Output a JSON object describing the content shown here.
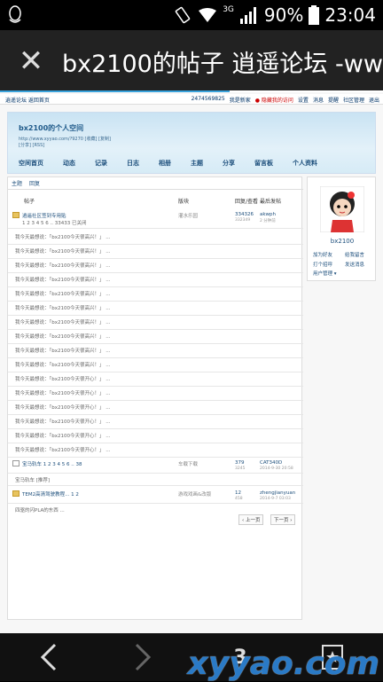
{
  "status": {
    "network": "3G",
    "battery": "90%",
    "time": "23:04"
  },
  "browser": {
    "title": "bx2100的帖子 逍遥论坛 -ww",
    "load_progress": 0.6
  },
  "site": {
    "topnav_left": "逍遥论坛  返回首页",
    "topnav_id": "2474569825",
    "topnav_items": [
      "我是新家",
      "● 隐藏我的访问",
      "设置",
      "消息",
      "提醒",
      "社区管理",
      "退出"
    ],
    "space_name": "bx2100的个人空间",
    "space_url": "http://www.xyyao.com/?9270 [收藏] [复制]",
    "space_rss": "[分享] [RSS]",
    "tabs": [
      "空间首页",
      "动态",
      "记录",
      "日志",
      "相册",
      "主题",
      "分享",
      "留言板",
      "个人资料"
    ]
  },
  "list": {
    "subtabs": [
      "主题",
      "回复"
    ],
    "headers": {
      "title": "帖子",
      "board": "版块",
      "stats": "回复/查看",
      "last": "最后发帖"
    },
    "pinned": {
      "title": "逍遥社区签到专用贴",
      "pages": "1 2 3 4 5 6 .. 33433  已关闭",
      "board": "灌水乐园",
      "stats": "334326",
      "stats2": "332349",
      "last": "akwph",
      "last2": "2 分钟前"
    },
    "reply_rows": [
      "我今天最想说：「bx2100今天很高兴！」 ...",
      "我今天最想说：「bx2100今天很高兴！」 ...",
      "我今天最想说：「bx2100今天很高兴！」 ...",
      "我今天最想说：「bx2100今天很高兴！」 ...",
      "我今天最想说：「bx2100今天很高兴！」 ...",
      "我今天最想说：「bx2100今天很高兴！」 ...",
      "我今天最想说：「bx2100今天很高兴！」 ...",
      "我今天最想说：「bx2100今天很高兴！」 ...",
      "我今天最想说：「bx2100今天很高兴！」 ...",
      "我今天最想说：「bx2100今天很高兴！」 ...",
      "我今天最想说：「bx2100今天很开心！」 ...",
      "我今天最想说：「bx2100今天很开心！」 ...",
      "我今天最想说：「bx2100今天很开心！」 ...",
      "我今天最想说：「bx2100今天很开心！」 ...",
      "我今天最想说：「bx2100今天很开心！」 ...",
      "我今天最想说：「bx2100今天很开心！」 ..."
    ],
    "thread2": {
      "title": "宝马轨车  1 2 3 4 5 6 .. 38",
      "board": "车载下载",
      "stats": "379",
      "stats2": "3245",
      "last": "CAT340D",
      "last2": "2014-9-30 20:58",
      "reply": "宝马轨车 [推荐]"
    },
    "thread3": {
      "title": "TEM2高清驾驶教程...  1 2",
      "board": "游戏戏画&改版",
      "stats": "12",
      "stats2": "458",
      "last": "zhengjianyuan",
      "last2": "2014-9-7 03:03",
      "reply": "四驱的闪PLA的东西 ..."
    },
    "prev": "‹ 上一页",
    "next": "下一页 ›"
  },
  "profile": {
    "username": "bx2100",
    "add_friend": "加为好友",
    "greet": "给我留言",
    "poke": "打个招呼",
    "message": "发送消息",
    "manage": "用户管理 ▾"
  },
  "nav": {
    "back": "‹",
    "forward": "›",
    "tab_count": "3"
  },
  "watermark": "xyyao.com",
  "colors": {
    "accent": "#3aa3dc",
    "link": "#1d4f7c",
    "titlebar": "#222222"
  }
}
